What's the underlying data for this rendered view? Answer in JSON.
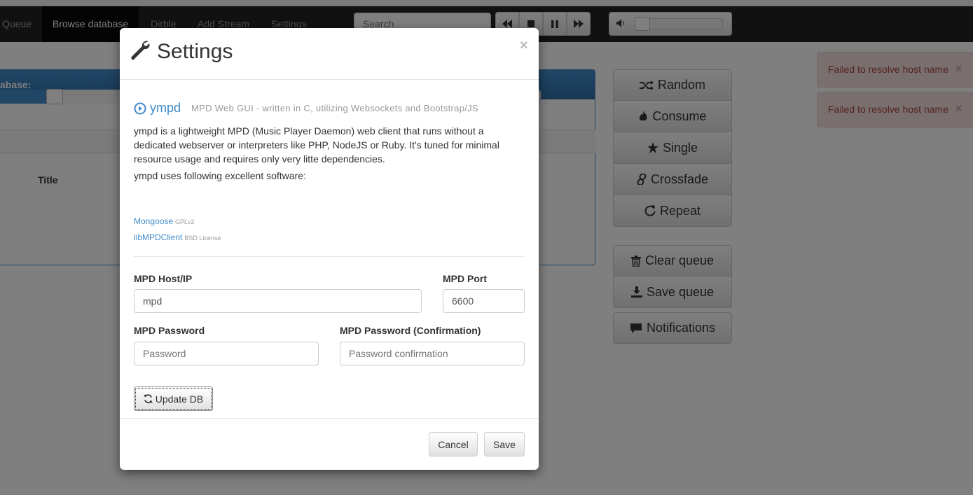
{
  "navbar": {
    "items": [
      {
        "label": "Queue",
        "active": false
      },
      {
        "label": "Browse database",
        "active": true
      },
      {
        "label": "Dirble",
        "active": false
      },
      {
        "label": "Add Stream",
        "active": false
      },
      {
        "label": "Settings",
        "active": false
      }
    ],
    "search_placeholder": "Search",
    "player_buttons": [
      "backward-icon",
      "stop-icon",
      "pause-icon",
      "forward-icon"
    ],
    "volume_icon": "volume-icon"
  },
  "background": {
    "panel_heading": "abase:",
    "column_title": "Title"
  },
  "side_controls": {
    "modes": [
      {
        "label": "Random",
        "icon": "random-icon"
      },
      {
        "label": "Consume",
        "icon": "fire-icon"
      },
      {
        "label": "Single",
        "icon": "star-icon"
      },
      {
        "label": "Crossfade",
        "icon": "link-icon"
      },
      {
        "label": "Repeat",
        "icon": "repeat-icon"
      }
    ],
    "queue": [
      {
        "label": "Clear queue",
        "icon": "trash-icon"
      },
      {
        "label": "Save queue",
        "icon": "download-icon"
      }
    ],
    "notifications": {
      "label": "Notifications",
      "icon": "comment-icon"
    }
  },
  "alerts": [
    {
      "text": "Failed to resolve host name",
      "close": "×"
    },
    {
      "text": "Failed to resolve host name",
      "close": "×"
    }
  ],
  "modal": {
    "title": "Settings",
    "close": "×",
    "brand": "ympd",
    "brand_subtitle": "MPD Web GUI - written in C, utilizing Websockets and Bootstrap/JS",
    "description": "ympd is a lightweight MPD (Music Player Daemon) web client that runs without a dedicated webserver or interpreters like PHP, NodeJS or Ruby. It's tuned for minimal resource usage and requires only very litte dependencies.",
    "uses": "ympd uses following excellent software:",
    "libraries": [
      {
        "name": "Mongoose",
        "license": "GPLv2"
      },
      {
        "name": "libMPDClient",
        "license": "BSD License"
      }
    ],
    "form": {
      "host_label": "MPD Host/IP",
      "host_value": "mpd",
      "port_label": "MPD Port",
      "port_value": "6600",
      "password_label": "MPD Password",
      "password_placeholder": "Password",
      "confirm_label": "MPD Password (Confirmation)",
      "confirm_placeholder": "Password confirmation"
    },
    "update_db": "Update DB",
    "cancel": "Cancel",
    "save": "Save"
  },
  "colors": {
    "accent": "#428bca",
    "navbar": "#222222",
    "alert_bg": "#f2dede",
    "alert_text": "#a94442"
  }
}
